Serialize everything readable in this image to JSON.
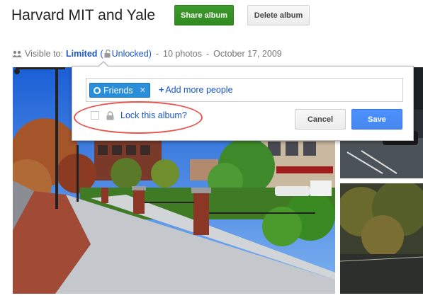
{
  "album": {
    "title": "Harvard MIT and Yale",
    "share_label": "Share album",
    "delete_label": "Delete album"
  },
  "meta": {
    "visible_to_label": "Visible to:",
    "visibility": "Limited",
    "paren_open": "(",
    "lock_state": "Unlocked)",
    "dash1": "-",
    "photo_count": "10 photos",
    "dash2": "-",
    "date": "October 17, 2009"
  },
  "popup": {
    "chip_label": "Friends",
    "chip_remove": "✕",
    "add_more_people": "Add more people",
    "add_plus": "+",
    "lock_label": "Lock this album?",
    "lock_checked": false,
    "cancel_label": "Cancel",
    "save_label": "Save"
  },
  "colors": {
    "share_green": "#2f8a1f",
    "link_blue": "#1a56c9",
    "save_blue": "#4787ed",
    "chip_blue": "#2a8ed8",
    "highlight_red": "#e8524a"
  },
  "icons": [
    "people-icon",
    "lock-icon",
    "circle-icon",
    "close-icon",
    "plus-icon"
  ]
}
